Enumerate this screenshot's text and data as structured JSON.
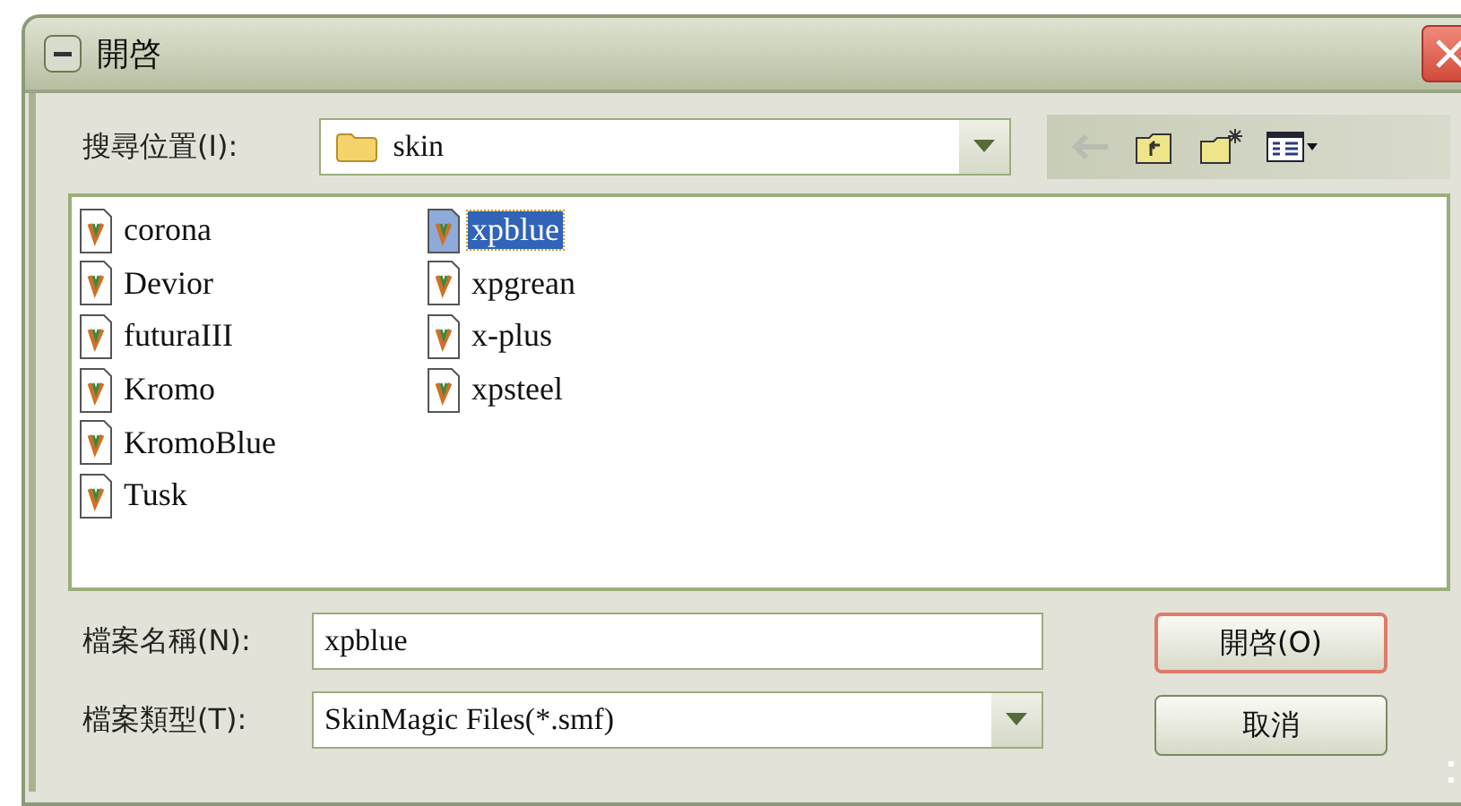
{
  "window": {
    "title": "開啓"
  },
  "look_in": {
    "label": "搜尋位置(I):",
    "value": "skin"
  },
  "files": [
    {
      "name": "corona",
      "selected": false
    },
    {
      "name": "Devior",
      "selected": false
    },
    {
      "name": "futuraIII",
      "selected": false
    },
    {
      "name": "Kromo",
      "selected": false
    },
    {
      "name": "KromoBlue",
      "selected": false
    },
    {
      "name": "Tusk",
      "selected": false
    },
    {
      "name": "xpblue",
      "selected": true
    },
    {
      "name": "xpgrean",
      "selected": false
    },
    {
      "name": "x-plus",
      "selected": false
    },
    {
      "name": "xpsteel",
      "selected": false
    }
  ],
  "file_name": {
    "label": "檔案名稱(N):",
    "value": "xpblue"
  },
  "file_type": {
    "label": "檔案類型(T):",
    "value": "SkinMagic Files(*.smf)"
  },
  "buttons": [
    {
      "label": "開啓(O)",
      "default": true
    },
    {
      "label": "取消",
      "default": false
    }
  ]
}
